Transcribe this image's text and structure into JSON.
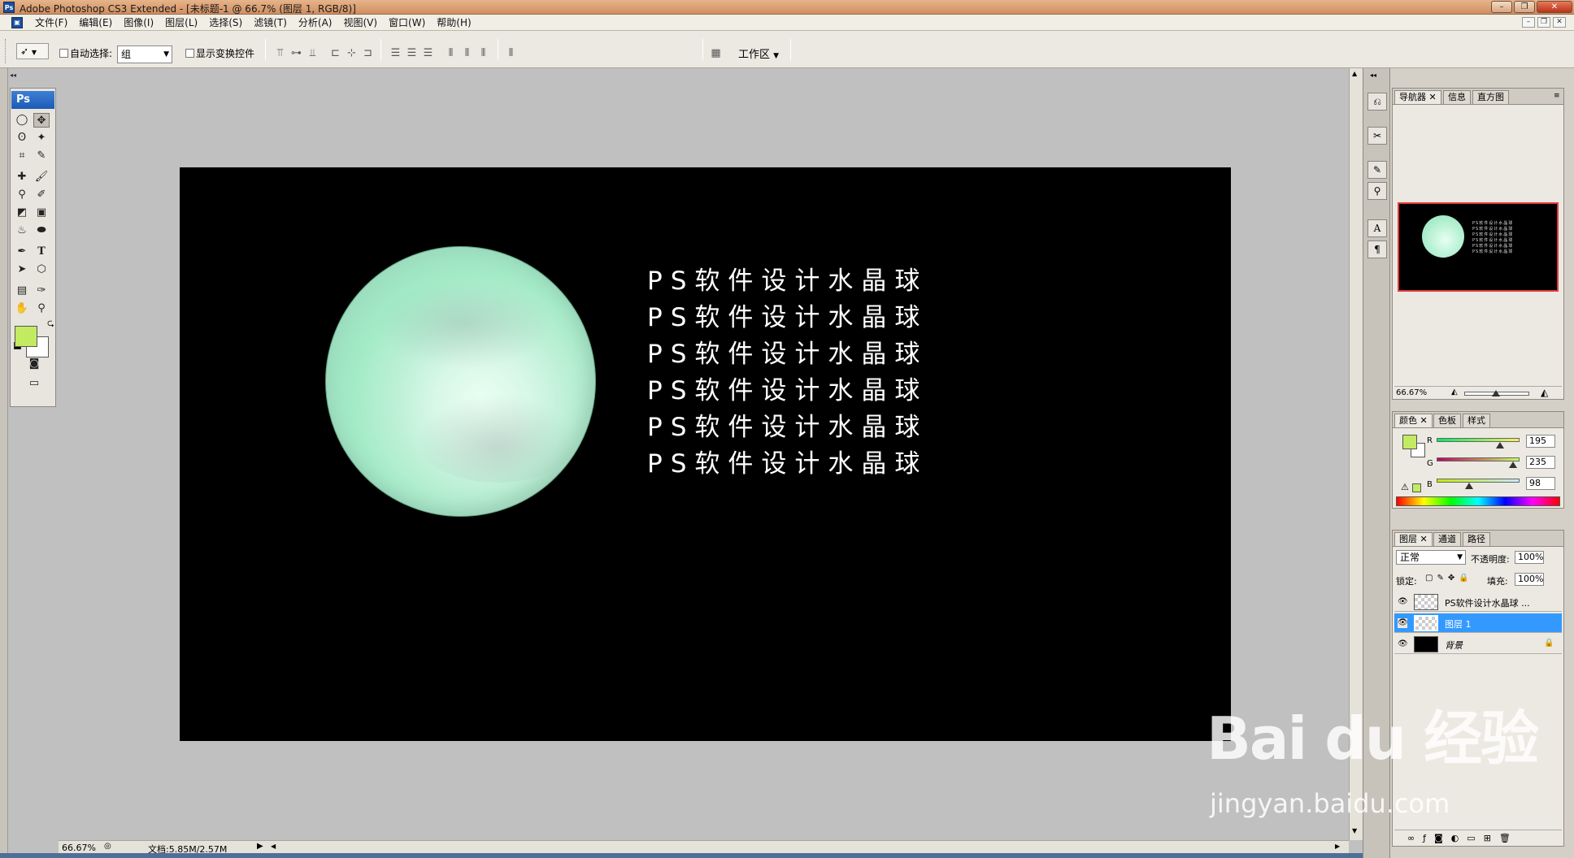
{
  "window": {
    "title": "Adobe Photoshop CS3 Extended - [未标题-1 @ 66.7% (图层 1, RGB/8)]",
    "app_icon": "Ps"
  },
  "menu": [
    "文件(F)",
    "编辑(E)",
    "图像(I)",
    "图层(L)",
    "选择(S)",
    "滤镜(T)",
    "分析(A)",
    "视图(V)",
    "窗口(W)",
    "帮助(H)"
  ],
  "options": {
    "auto_select_label": "自动选择:",
    "auto_select_value": "组",
    "show_transform_label": "显示变换控件",
    "workspace_label": "工作区"
  },
  "toolbox": {
    "header": "Ps",
    "fg_color": "#c3eb62",
    "bg_color": "#ffffff"
  },
  "document": {
    "text_lines": [
      "PS软件设计水晶球",
      "PS软件设计水晶球",
      "PS软件设计水晶球",
      "PS软件设计水晶球",
      "PS软件设计水晶球",
      "PS软件设计水晶球"
    ],
    "sphere_color": "#a3ebc7",
    "background_color": "#000000"
  },
  "status": {
    "zoom": "66.67%",
    "doc_size": "文档:5.85M/2.57M"
  },
  "navigator": {
    "tabs": [
      "导航器",
      "信息",
      "直方图"
    ],
    "zoom": "66.67%"
  },
  "color_panel": {
    "tabs": [
      "颜色",
      "色板",
      "样式"
    ],
    "channels": [
      {
        "label": "R",
        "value": "195"
      },
      {
        "label": "G",
        "value": "235"
      },
      {
        "label": "B",
        "value": "98"
      }
    ]
  },
  "layers_panel": {
    "tabs": [
      "图层",
      "通道",
      "路径"
    ],
    "blend_mode": "正常",
    "opacity_label": "不透明度:",
    "opacity": "100%",
    "lock_label": "锁定:",
    "fill_label": "填充:",
    "fill": "100%",
    "layers": [
      {
        "name": "PS软件设计水晶球 ...",
        "selected": false
      },
      {
        "name": "图层 1",
        "selected": true
      },
      {
        "name": "背景",
        "selected": false
      }
    ]
  },
  "watermark": {
    "brand": "Bai du 经验",
    "url": "jingyan.baidu.com"
  }
}
